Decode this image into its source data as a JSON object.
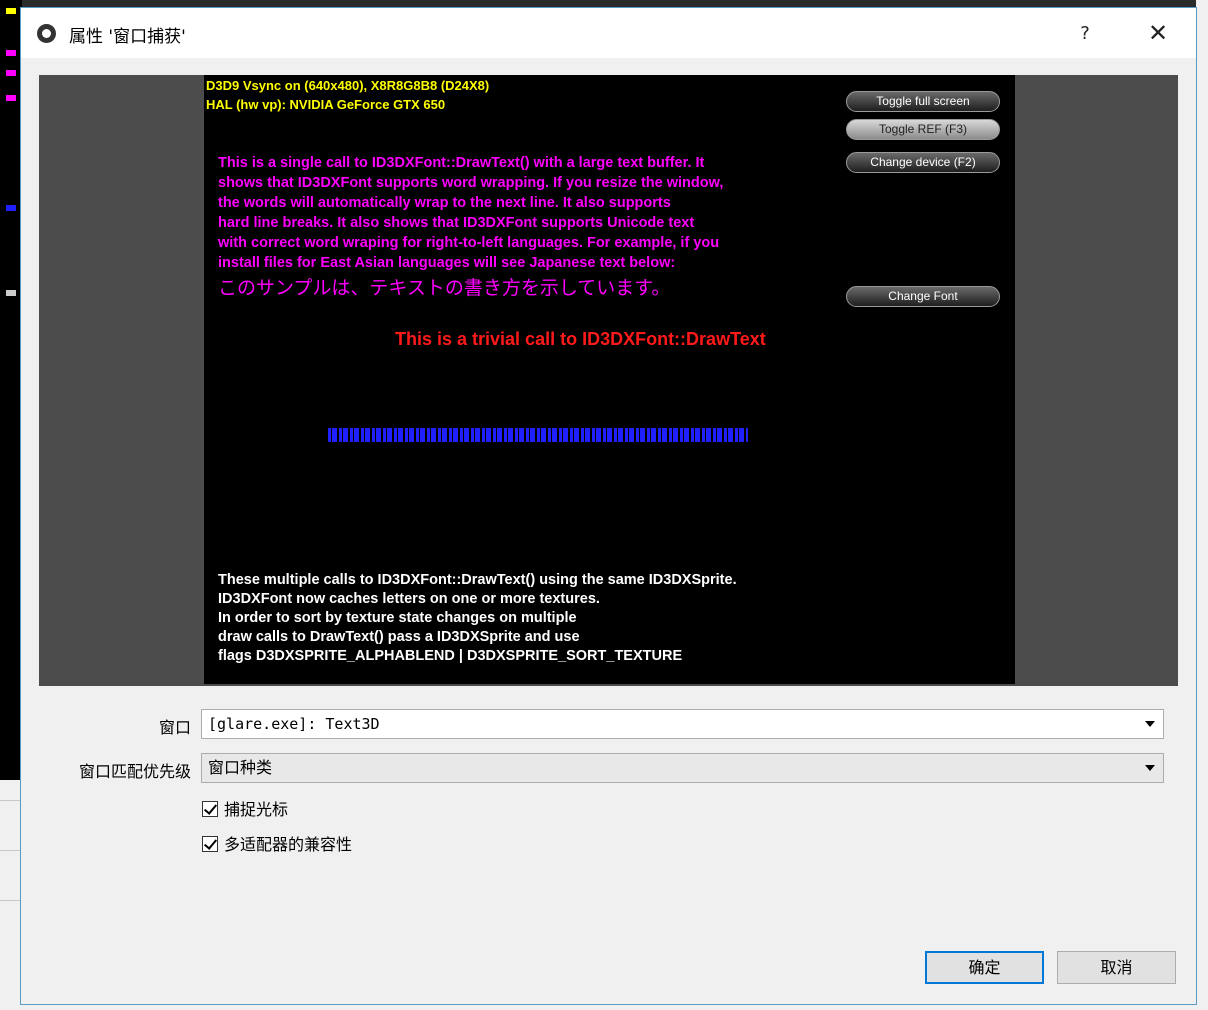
{
  "dialog": {
    "title": "属性 '窗口捕获'",
    "help_label": "?",
    "close_label": "✕"
  },
  "preview": {
    "hud_line1": "D3D9 Vsync on (640x480), X8R8G8B8 (D24X8)",
    "hud_line2": "HAL (hw vp): NVIDIA GeForce GTX 650",
    "buttons": {
      "toggle_full_screen": "Toggle full screen",
      "toggle_ref": "Toggle REF (F3)",
      "change_device": "Change device (F2)",
      "change_font": "Change Font"
    },
    "pink_lines": [
      "This is a single call to ID3DXFont::DrawText() with a large text buffer.  It",
      "shows that ID3DXFont supports word wrapping.  If you resize the window,",
      "the words will automatically wrap to the next line.  It also supports",
      "hard line breaks.  It also shows that ID3DXFont supports Unicode text",
      "with correct word wraping for right-to-left languages.  For example, if you",
      "install files for East Asian languages will see Japanese text below:"
    ],
    "japanese_line": "このサンプルは、テキストの書き方を示しています。",
    "red_text": "This is a trivial call to ID3DXFont::DrawText",
    "white_lines": [
      "These multiple calls to ID3DXFont::DrawText() using the same ID3DXSprite.",
      "ID3DXFont now caches letters on one or more textures.",
      "In order to sort by texture state changes on multiple",
      "draw calls to DrawText() pass a ID3DXSprite and use",
      "flags D3DXSPRITE_ALPHABLEND | D3DXSPRITE_SORT_TEXTURE"
    ]
  },
  "form": {
    "window_label": "窗口",
    "window_value": "[glare.exe]: Text3D",
    "priority_label": "窗口匹配优先级",
    "priority_value": "窗口种类",
    "capture_cursor_label": "捕捉光标",
    "multi_adapter_label": "多适配器的兼容性"
  },
  "footer": {
    "ok_label": "确定",
    "cancel_label": "取消"
  },
  "colors": {
    "hud": "#ffff00",
    "pink": "#ff00ff",
    "red": "#ff1a1a",
    "blue": "#2020ff",
    "accent": "#0078d7"
  }
}
